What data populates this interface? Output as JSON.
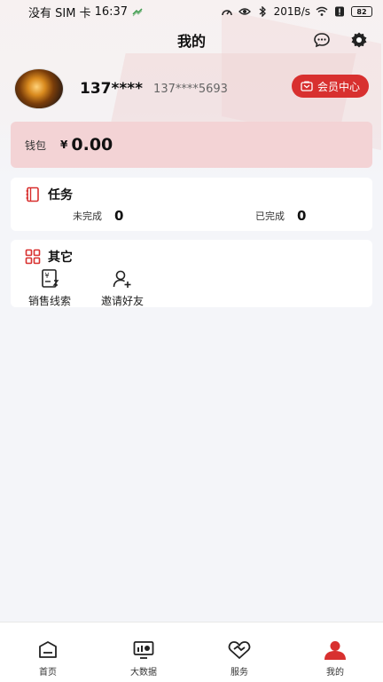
{
  "status_bar": {
    "carrier": "没有 SIM 卡",
    "time": "16:37",
    "speed": "201B/s",
    "battery": "82"
  },
  "header": {
    "title": "我的"
  },
  "profile": {
    "nickname": "137****",
    "phone": "137****5693",
    "vip_label": "会员中心"
  },
  "wallet": {
    "label": "钱包",
    "currency": "¥",
    "amount": "0.00"
  },
  "tasks": {
    "title": "任务",
    "pending_label": "未完成",
    "pending_count": "0",
    "done_label": "已完成",
    "done_count": "0"
  },
  "other": {
    "title": "其它",
    "items": [
      {
        "label": "销售线索",
        "icon": "sales-leads-icon"
      },
      {
        "label": "邀请好友",
        "icon": "invite-friend-icon"
      }
    ]
  },
  "tab_bar": {
    "items": [
      {
        "label": "首页",
        "icon": "home-icon",
        "active": false
      },
      {
        "label": "大数据",
        "icon": "big-data-icon",
        "active": false
      },
      {
        "label": "服务",
        "icon": "service-icon",
        "active": false
      },
      {
        "label": "我的",
        "icon": "profile-icon",
        "active": true
      }
    ]
  },
  "colors": {
    "accent": "#d8302f",
    "wallet_bg": "#f3d3d5",
    "page_bg": "#f4f5f9"
  }
}
